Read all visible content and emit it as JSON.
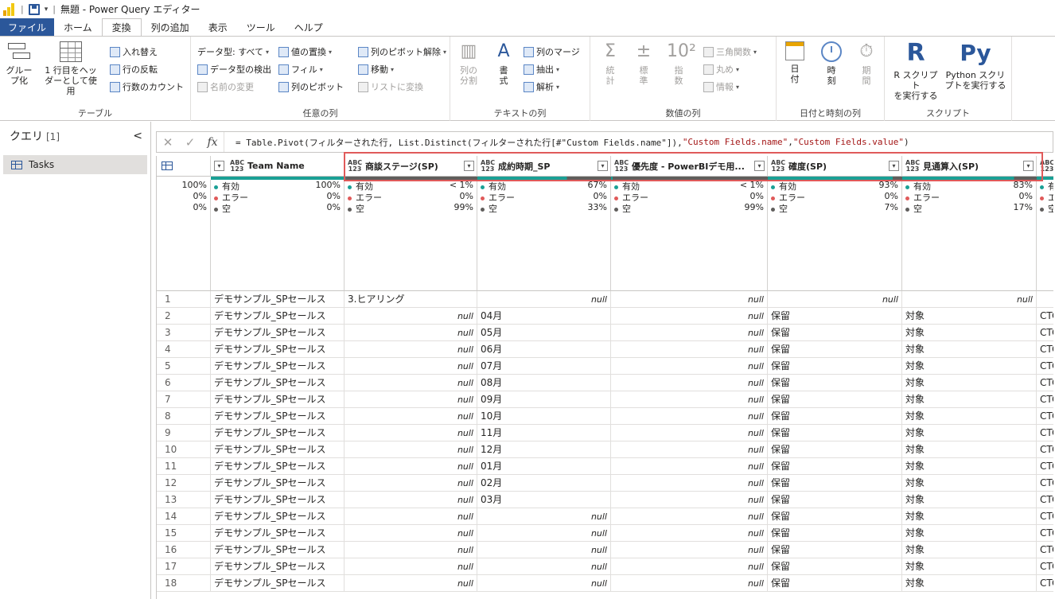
{
  "titlebar": {
    "title": "無題 - Power Query エディター"
  },
  "tabs": [
    "ファイル",
    "ホーム",
    "変換",
    "列の追加",
    "表示",
    "ツール",
    "ヘルプ"
  ],
  "ribbon": {
    "table_group": {
      "label": "テーブル",
      "group_by": "グルー\nプ化",
      "use_first_row": "1 行目をヘッ\nダーとして使用",
      "transpose": "入れ替え",
      "reverse_rows": "行の反転",
      "count_rows": "行数のカウント"
    },
    "any_column_group": {
      "label": "任意の列",
      "data_type": "データ型: すべて",
      "replace_values": "値の置換",
      "unpivot": "列のピボット解除",
      "detect_type": "データ型の検出",
      "fill": "フィル",
      "move": "移動",
      "rename": "名前の変更",
      "pivot": "列のピボット",
      "to_list": "リストに変換"
    },
    "text_group": {
      "label": "テキストの列",
      "split": "列の\n分割",
      "format": "書\n式",
      "merge": "列のマージ",
      "extract": "抽出",
      "parse": "解析"
    },
    "number_group": {
      "label": "数値の列",
      "stats": "統\n計",
      "standard": "標\n準",
      "scientific": "指\n数",
      "trig": "三角関数",
      "rounding": "丸め",
      "info": "情報"
    },
    "datetime_group": {
      "label": "日付と時刻の列",
      "date": "日\n付",
      "time": "時\n刻",
      "duration": "期\n間"
    },
    "script_group": {
      "label": "スクリプト",
      "r_script": "R スクリプト\nを実行する",
      "python_script": "Python スクリ\nプトを実行する",
      "r_icon": "R",
      "py_icon": "Py"
    }
  },
  "queries": {
    "title": "クエリ",
    "count": "[1]",
    "collapse": "<",
    "items": [
      "Tasks"
    ]
  },
  "formula": {
    "prefix": "= Table.Pivot(フィルターされた行, List.Distinct(フィルターされた行[#\"Custom Fields.name\"]), ",
    "arg1": "\"Custom Fields.name\"",
    "sep": ", ",
    "arg2": "\"Custom Fields.value\"",
    "suffix": ")"
  },
  "columns": [
    {
      "type": "ABC\n123",
      "name": "Team Name",
      "valid": "100%",
      "error": "0%",
      "empty": "0%"
    },
    {
      "type": "ABC\n123",
      "name": "商談ステージ(SP)",
      "valid": "< 1%",
      "error": "0%",
      "empty": "99%"
    },
    {
      "type": "ABC\n123",
      "name": "成約時期_SP",
      "valid": "67%",
      "error": "0%",
      "empty": "33%"
    },
    {
      "type": "ABC\n123",
      "name": "優先度 - PowerBIデモ用...",
      "valid": "< 1%",
      "error": "0%",
      "empty": "99%"
    },
    {
      "type": "ABC\n123",
      "name": "確度(SP)",
      "valid": "93%",
      "error": "0%",
      "empty": "7%"
    },
    {
      "type": "ABC\n123",
      "name": "見通算入(SP)",
      "valid": "83%",
      "error": "0%",
      "empty": "17%"
    },
    {
      "type": "ABC\n123",
      "name": "",
      "valid": "",
      "error": "",
      "empty": ""
    }
  ],
  "profile_labels": {
    "valid": "有効",
    "error": "エラー",
    "empty": "空"
  },
  "rowindex_profile": {
    "valid": "100%",
    "error": "0%",
    "empty": "0%"
  },
  "rows": [
    [
      "1",
      "デモサンプル_SPセールス",
      "3.ヒアリング",
      "null",
      "null",
      "null",
      "null",
      ""
    ],
    [
      "2",
      "デモサンプル_SPセールス",
      "null",
      "04月",
      "null",
      "保留",
      "対象",
      "CTC"
    ],
    [
      "3",
      "デモサンプル_SPセールス",
      "null",
      "05月",
      "null",
      "保留",
      "対象",
      "CTC"
    ],
    [
      "4",
      "デモサンプル_SPセールス",
      "null",
      "06月",
      "null",
      "保留",
      "対象",
      "CTC"
    ],
    [
      "5",
      "デモサンプル_SPセールス",
      "null",
      "07月",
      "null",
      "保留",
      "対象",
      "CTC"
    ],
    [
      "6",
      "デモサンプル_SPセールス",
      "null",
      "08月",
      "null",
      "保留",
      "対象",
      "CTC"
    ],
    [
      "7",
      "デモサンプル_SPセールス",
      "null",
      "09月",
      "null",
      "保留",
      "対象",
      "CTC"
    ],
    [
      "8",
      "デモサンプル_SPセールス",
      "null",
      "10月",
      "null",
      "保留",
      "対象",
      "CTC"
    ],
    [
      "9",
      "デモサンプル_SPセールス",
      "null",
      "11月",
      "null",
      "保留",
      "対象",
      "CTC"
    ],
    [
      "10",
      "デモサンプル_SPセールス",
      "null",
      "12月",
      "null",
      "保留",
      "対象",
      "CTC"
    ],
    [
      "11",
      "デモサンプル_SPセールス",
      "null",
      "01月",
      "null",
      "保留",
      "対象",
      "CTC"
    ],
    [
      "12",
      "デモサンプル_SPセールス",
      "null",
      "02月",
      "null",
      "保留",
      "対象",
      "CTC"
    ],
    [
      "13",
      "デモサンプル_SPセールス",
      "null",
      "03月",
      "null",
      "保留",
      "対象",
      "CTC"
    ],
    [
      "14",
      "デモサンプル_SPセールス",
      "null",
      "null",
      "null",
      "保留",
      "対象",
      "CTC"
    ],
    [
      "15",
      "デモサンプル_SPセールス",
      "null",
      "null",
      "null",
      "保留",
      "対象",
      "CTC"
    ],
    [
      "16",
      "デモサンプル_SPセールス",
      "null",
      "null",
      "null",
      "保留",
      "対象",
      "CTC"
    ],
    [
      "17",
      "デモサンプル_SPセールス",
      "null",
      "null",
      "null",
      "保留",
      "対象",
      "CTC"
    ],
    [
      "18",
      "デモサンプル_SPセールス",
      "null",
      "null",
      "null",
      "保留",
      "対象",
      "CTC"
    ]
  ],
  "colors": {
    "file_tab": "#2b579a",
    "valid": "#1aa095",
    "error": "#e05a5a",
    "empty": "#605e5c",
    "highlight": "#e05a5a"
  }
}
